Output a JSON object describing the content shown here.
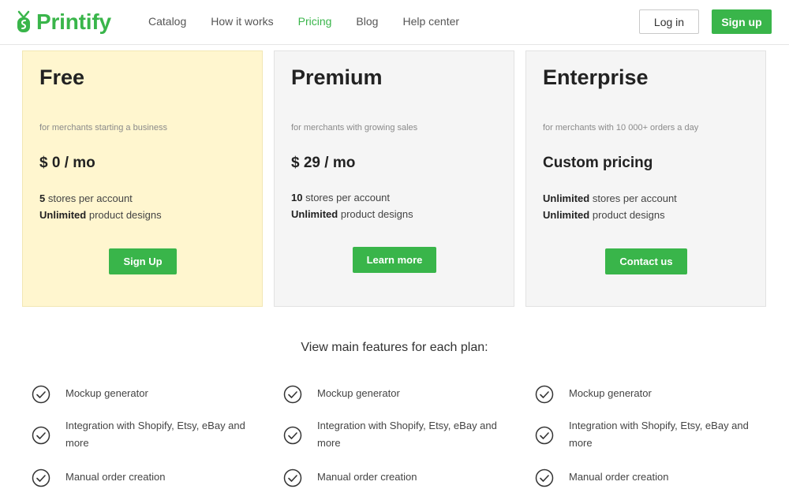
{
  "header": {
    "logo_text": "Printify",
    "nav": [
      "Catalog",
      "How it works",
      "Pricing",
      "Blog",
      "Help center"
    ],
    "active_nav": "Pricing",
    "login_label": "Log in",
    "signup_label": "Sign up"
  },
  "plans": [
    {
      "name": "Free",
      "subtitle": "for merchants starting a business",
      "price": "$ 0 / mo",
      "line1_bold": "5",
      "line1_rest": " stores per account",
      "line2_bold": "Unlimited",
      "line2_rest": " product designs",
      "button": "Sign Up"
    },
    {
      "name": "Premium",
      "subtitle": "for merchants with growing sales",
      "price": "$ 29 / mo",
      "line1_bold": "10",
      "line1_rest": " stores per account",
      "line2_bold": "Unlimited",
      "line2_rest": " product designs",
      "button": "Learn more"
    },
    {
      "name": "Enterprise",
      "subtitle": "for merchants with 10 000+ orders a day",
      "price": "Custom pricing",
      "line1_bold": "Unlimited",
      "line1_rest": " stores per account",
      "line2_bold": "Unlimited",
      "line2_rest": " product designs",
      "button": "Contact us"
    }
  ],
  "features": {
    "heading": "View main features for each plan:",
    "items": [
      "Mockup generator",
      "Integration with Shopify, Etsy, eBay and more",
      "Manual order creation"
    ]
  },
  "colors": {
    "brand_green": "#39b54a",
    "free_card_bg": "#fff6cf",
    "card_bg": "#f5f5f5"
  }
}
